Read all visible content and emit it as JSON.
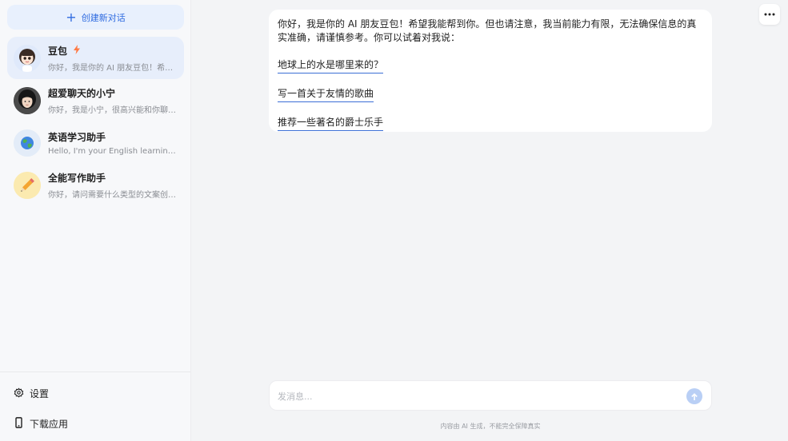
{
  "sidebar": {
    "new_chat_label": "创建新对话",
    "conversations": [
      {
        "title": "豆包",
        "subtitle": "你好，我是你的 AI 朋友豆包！希望…",
        "active": true
      },
      {
        "title": "超爱聊天的小宁",
        "subtitle": "你好，我是小宁，很高兴能和你聊…",
        "active": false
      },
      {
        "title": "英语学习助手",
        "subtitle": "Hello, I'm your English learning ass…",
        "active": false
      },
      {
        "title": "全能写作助手",
        "subtitle": "你好，请问需要什么类型的文案创…",
        "active": false
      }
    ],
    "settings_label": "设置",
    "download_label": "下载应用"
  },
  "chat": {
    "message_intro": "你好，我是你的 AI 朋友豆包！希望我能帮到你。但也请注意，我当前能力有限，无法确保信息的真实准确，请谨慎参考。你可以试着对我说：",
    "suggestions": [
      "地球上的水是哪里来的？",
      "写一首关于友情的歌曲",
      "推荐一些著名的爵士乐手"
    ]
  },
  "composer": {
    "placeholder": "发消息..."
  },
  "footer": {
    "disclaimer": "内容由 AI 生成，不能完全保障真实"
  },
  "icons": {
    "new_chat": "plus-icon",
    "bolt": "lightning-icon",
    "settings": "gear-icon",
    "download": "phone-icon",
    "more": "more-icon",
    "send": "arrow-up-icon"
  },
  "colors": {
    "accent": "#2f6be0",
    "active_item_bg": "#e7eefb",
    "bolt": "#ff7a45",
    "send_disabled": "#b9cff5",
    "link_underline": "#3b6fd6"
  }
}
